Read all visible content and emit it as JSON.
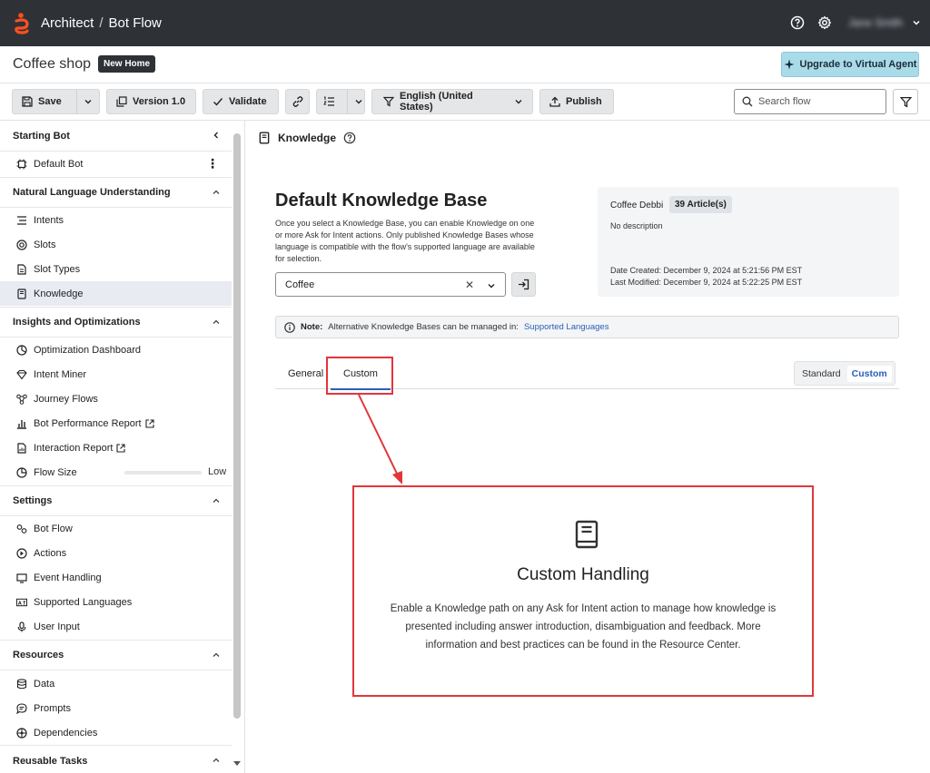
{
  "topbar": {
    "breadcrumb": [
      "Architect",
      "Bot Flow"
    ],
    "separator": "/",
    "user_name": "Jane Smith"
  },
  "titlerow": {
    "flow_name": "Coffee shop",
    "badge": "New Home",
    "upgrade_label": "Upgrade to Virtual Agent"
  },
  "toolbar": {
    "save_label": "Save",
    "version_label": "Version 1.0",
    "validate_label": "Validate",
    "language_label": "English (United States)",
    "publish_label": "Publish",
    "search_placeholder": "Search flow"
  },
  "sidebar": {
    "starting_bot": {
      "heading": "Starting Bot",
      "item": "Default Bot"
    },
    "nlu": {
      "heading": "Natural Language Understanding",
      "items": [
        "Intents",
        "Slots",
        "Slot Types",
        "Knowledge"
      ]
    },
    "insights": {
      "heading": "Insights and Optimizations",
      "items": [
        "Optimization Dashboard",
        "Intent Miner",
        "Journey Flows",
        "Bot Performance Report",
        "Interaction Report",
        "Flow Size"
      ],
      "flow_size_value": "Low",
      "flow_size_fraction": 0.0
    },
    "settings": {
      "heading": "Settings",
      "items": [
        "Bot Flow",
        "Actions",
        "Event Handling",
        "Supported Languages",
        "User Input"
      ]
    },
    "resources": {
      "heading": "Resources",
      "items": [
        "Data",
        "Prompts",
        "Dependencies"
      ]
    },
    "reusable": {
      "heading": "Reusable Tasks"
    }
  },
  "main": {
    "header": "Knowledge",
    "kb_title": "Default Knowledge Base",
    "kb_description": "Once you select a Knowledge Base, you can enable Knowledge on one or more Ask for Intent actions. Only published Knowledge Bases whose language is compatible with the flow's supported language are available for selection.",
    "kb_selected": "Coffee",
    "info": {
      "name": "Coffee Debbi",
      "count": "39 Article(s)",
      "description": "No description",
      "created": "Date Created: December 9, 2024 at 5:21:56 PM EST",
      "modified": "Last Modified: December 9, 2024 at 5:22:25 PM EST"
    },
    "note": {
      "label": "Note:",
      "text": "Alternative Knowledge Bases can be managed in:",
      "link": "Supported Languages"
    },
    "tabs": [
      "General",
      "Custom"
    ],
    "active_tab": "Custom",
    "toggle": [
      "Standard",
      "Custom"
    ],
    "toggle_active": "Custom",
    "custom_handling": {
      "title": "Custom Handling",
      "description": "Enable a Knowledge path on any Ask for Intent action to manage how knowledge is presented including answer introduction, disambiguation and feedback. More information and best practices can be found in the Resource Center."
    }
  },
  "colors": {
    "topbar": "#2e3237",
    "accent": "#2a60b8",
    "logo": "#ff4f1f",
    "highlight": "#e2363a",
    "upgrade": "#a9dbe8"
  }
}
